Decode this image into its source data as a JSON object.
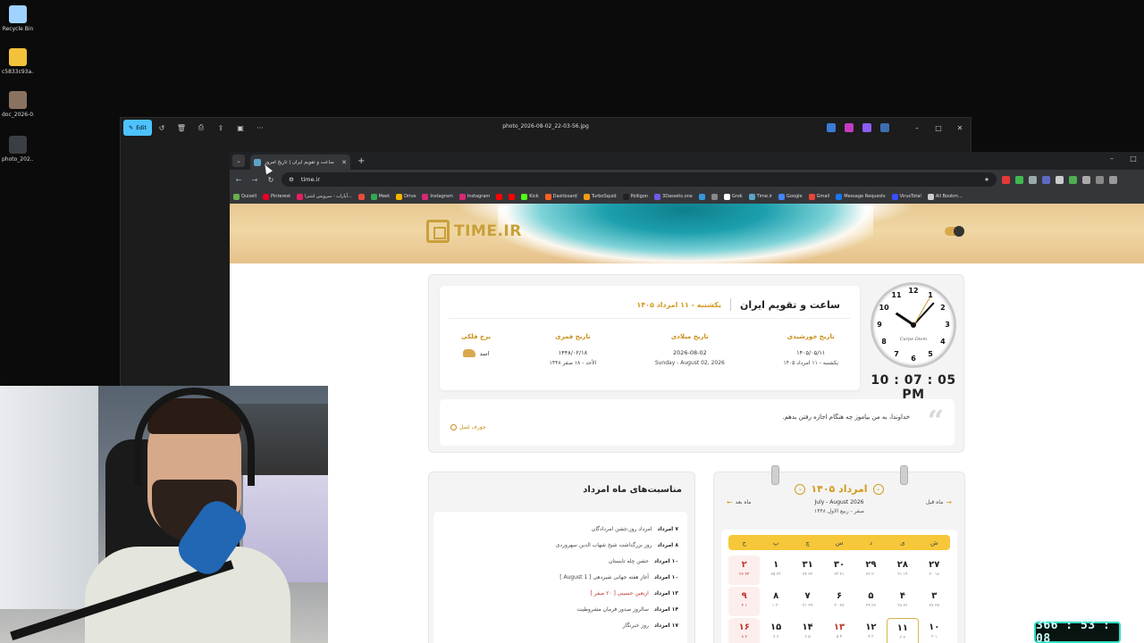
{
  "desktop": {
    "icons": [
      {
        "label": "Recycle Bin",
        "icon": "recycle-bin-icon",
        "color": "#9fd3ff"
      },
      {
        "label": "c5833c93a...",
        "icon": "emoji-file-icon",
        "color": "#f2c23a"
      },
      {
        "label": "doc_2026-0...",
        "icon": "image-file-icon",
        "color": "#8a7260"
      },
      {
        "label": "photo_202...",
        "icon": "image-file-icon",
        "color": "#3a3f45"
      }
    ]
  },
  "viewer": {
    "title": "photo_2026-08-02_22-03-56.jpg",
    "edit_label": "Edit",
    "tools": [
      "rotate-icon",
      "delete-icon",
      "print-icon",
      "share-icon",
      "slideshow-icon",
      "more-icon"
    ],
    "window_controls": [
      "–",
      "□",
      "✕"
    ]
  },
  "browser": {
    "tab_title": "ساعت و تقویم ایران | تاریخ امروز",
    "url": "time.ir",
    "window_controls": [
      "–",
      "□"
    ],
    "bookmarks": [
      {
        "label": "Quizell",
        "color": "#6ab04c"
      },
      {
        "label": "Pinterest",
        "color": "#e60023"
      },
      {
        "label": "آپارات - سرویس اشترا...",
        "color": "#ea1d5d"
      },
      {
        "label": "",
        "color": "#e74c3c"
      },
      {
        "label": "Meet",
        "color": "#34a853"
      },
      {
        "label": "Drive",
        "color": "#f4b400"
      },
      {
        "label": "Instagram",
        "color": "#d62976"
      },
      {
        "label": "Instagram",
        "color": "#d62976"
      },
      {
        "label": "",
        "color": "#ff0000"
      },
      {
        "label": "",
        "color": "#ff0000"
      },
      {
        "label": "Kick",
        "color": "#53fc18"
      },
      {
        "label": "Dashboard",
        "color": "#ff5f1f"
      },
      {
        "label": "TurboSquid",
        "color": "#f39c12"
      },
      {
        "label": "Poliigon",
        "color": "#222"
      },
      {
        "label": "3Dassets.one",
        "color": "#6c5ce7"
      },
      {
        "label": "",
        "color": "#3498db"
      },
      {
        "label": "",
        "color": "#888"
      },
      {
        "label": "Grok",
        "color": "#fff"
      },
      {
        "label": "Time.ir",
        "color": "#5aa5c9"
      },
      {
        "label": "Google",
        "color": "#4285f4"
      },
      {
        "label": "Gmail",
        "color": "#ea4335"
      },
      {
        "label": "Message Requests",
        "color": "#1877f2"
      },
      {
        "label": "VirusTotal",
        "color": "#394eff"
      },
      {
        "label": "All Bookm...",
        "color": "#ccc"
      }
    ]
  },
  "site": {
    "logo_text": "TIME.IR",
    "header": {
      "title": "ساعت و تقویم ایران",
      "today": "یکشنبه - ۱۱ امرداد ۱۴۰۵"
    },
    "dates": {
      "solar": {
        "label": "تاریخ خورشیدی",
        "v1": "۱۴۰۵/۰۵/۱۱",
        "v2": "یکشنبه - ۱۱ امرداد ۱۴۰۵"
      },
      "gregorian": {
        "label": "تاریخ میلادی",
        "v1": "2026-08-02",
        "v2": "Sunday - August 02, 2026"
      },
      "lunar": {
        "label": "تاریخ قمری",
        "v1": "۱۴۴۸/۰۲/۱۸",
        "v2": "الأحد - ۱۸ صفر ۱۴۴۸"
      },
      "zodiac": {
        "label": "برج فلکی",
        "v1": "اسد"
      }
    },
    "clock": {
      "numbers": [
        "12",
        "1",
        "2",
        "3",
        "4",
        "5",
        "6",
        "7",
        "8",
        "9",
        "10",
        "11"
      ],
      "brand": "Carpe Diem",
      "digital": "10 : 07 : 05  PM",
      "hours": 10,
      "minutes": 7,
      "seconds": 5
    },
    "quote": {
      "text": "خداوندا، به من بیاموز چه هنگام اجازه رفتن بدهم.",
      "link": "جورف لسل"
    },
    "events": {
      "title": "مناسبت‌های ماه امرداد",
      "items": [
        {
          "day": "۷ امرداد",
          "text": "امرداد روز،جشن امردادگان",
          "holiday": false
        },
        {
          "day": "۸ امرداد",
          "text": "روز بزرگداشت شیخ شهاب الدین سهروردی",
          "holiday": false
        },
        {
          "day": "۱۰ امرداد",
          "text": "جشن چله تابستان",
          "holiday": false
        },
        {
          "day": "۱۰ امرداد",
          "text": "آغاز هفته جهانی شیردهی [ 1 August ]",
          "holiday": false
        },
        {
          "day": "۱۳ امرداد",
          "text": "اربعین حسینی [ ۲۰ صفر ]",
          "holiday": true
        },
        {
          "day": "۱۴ امرداد",
          "text": "سالروز صدور فرمان مشروطیت",
          "holiday": false
        },
        {
          "day": "۱۷ امرداد",
          "text": "روز خبرنگار",
          "holiday": false
        }
      ]
    },
    "calendar": {
      "month": "امرداد ۱۴۰۵",
      "sub_gregorian": "July - August 2026",
      "sub_lunar": "صفر - ربیع الاول ۱۴۴۸",
      "prev_label": "ماه قبل",
      "next_label": "ماه بعد",
      "weekdays": [
        "ش",
        "ی",
        "د",
        "س",
        "چ",
        "پ",
        "ج"
      ],
      "days": [
        {
          "n": "۲۷",
          "g": "۱۸ ۲۰",
          "fri": false,
          "hol": false,
          "today": false
        },
        {
          "n": "۲۸",
          "g": "۱۹ ۲۱",
          "fri": false,
          "hol": false,
          "today": false
        },
        {
          "n": "۲۹",
          "g": "۲۰ ۲۲",
          "fri": false,
          "hol": false,
          "today": false
        },
        {
          "n": "۳۰",
          "g": "۲۱ ۲۳",
          "fri": false,
          "hol": false,
          "today": false
        },
        {
          "n": "۳۱",
          "g": "۲۲ ۲۴",
          "fri": false,
          "hol": false,
          "today": false
        },
        {
          "n": "۱",
          "g": "۲۳ ۲۵",
          "fri": false,
          "hol": false,
          "today": false
        },
        {
          "n": "۲",
          "g": "۲۴ ۲۶",
          "fri": true,
          "hol": false,
          "today": false
        },
        {
          "n": "۳",
          "g": "۲۵ ۲۷",
          "fri": false,
          "hol": false,
          "today": false
        },
        {
          "n": "۴",
          "g": "۲۶ ۲۸",
          "fri": false,
          "hol": false,
          "today": false
        },
        {
          "n": "۵",
          "g": "۲۷ ۲۹",
          "fri": false,
          "hol": false,
          "today": false
        },
        {
          "n": "۶",
          "g": "۲۸ ۳۰",
          "fri": false,
          "hol": false,
          "today": false
        },
        {
          "n": "۷",
          "g": "۲۹ ۳۱",
          "fri": false,
          "hol": false,
          "today": false
        },
        {
          "n": "۸",
          "g": "۳۰ ۱",
          "fri": false,
          "hol": false,
          "today": false
        },
        {
          "n": "۹",
          "g": "۱ ۲",
          "fri": true,
          "hol": false,
          "today": false
        },
        {
          "n": "۱۰",
          "g": "۱ ۲",
          "fri": false,
          "hol": false,
          "today": false
        },
        {
          "n": "۱۱",
          "g": "۲ ۳",
          "fri": false,
          "hol": false,
          "today": true
        },
        {
          "n": "۱۲",
          "g": "۳ ۴",
          "fri": false,
          "hol": false,
          "today": false
        },
        {
          "n": "۱۳",
          "g": "۴ ۵",
          "fri": false,
          "hol": true,
          "today": false
        },
        {
          "n": "۱۴",
          "g": "۵ ۶",
          "fri": false,
          "hol": false,
          "today": false
        },
        {
          "n": "۱۵",
          "g": "۶ ۷",
          "fri": false,
          "hol": false,
          "today": false
        },
        {
          "n": "۱۶",
          "g": "۷ ۸",
          "fri": true,
          "hol": false,
          "today": false
        }
      ]
    }
  },
  "timer": "366 : 53 : 08",
  "colors": {
    "accent": "#d39a1e",
    "weekday_bar": "#f7c73a",
    "holiday": "#c0392b",
    "edit_button": "#4cc2ff",
    "timer_border": "#2fe0c2"
  }
}
